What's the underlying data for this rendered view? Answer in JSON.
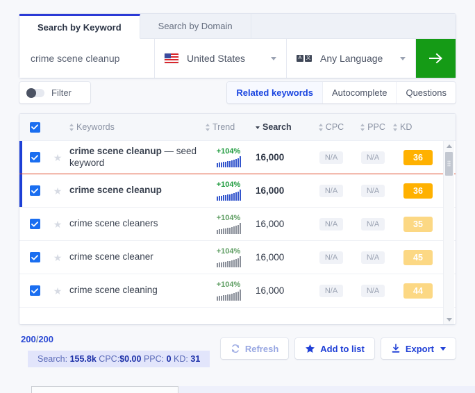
{
  "search_card": {
    "tabs": [
      {
        "label": "Search by Keyword",
        "active": true
      },
      {
        "label": "Search by Domain",
        "active": false
      }
    ],
    "keyword_value": "crime scene cleanup",
    "keyword_placeholder": "Enter keyword",
    "country": "United States",
    "country_icon": "us-flag-icon",
    "language": "Any Language",
    "language_icon": "translate-icon",
    "go_button_icon": "arrow-right-icon",
    "go_button_color": "#159b16"
  },
  "controls": {
    "filter_label": "Filter",
    "filter_enabled": false,
    "segments": [
      {
        "label": "Related keywords",
        "active": true
      },
      {
        "label": "Autocomplete",
        "active": false
      },
      {
        "label": "Questions",
        "active": false
      }
    ]
  },
  "table": {
    "select_all_checked": true,
    "columns": [
      {
        "key": "keywords",
        "label": "Keywords",
        "sort": "both",
        "active": false
      },
      {
        "key": "trend",
        "label": "Trend",
        "sort": "both",
        "active": false
      },
      {
        "key": "search",
        "label": "Search",
        "sort": "desc",
        "active": true
      },
      {
        "key": "cpc",
        "label": "CPC",
        "sort": "both",
        "active": false
      },
      {
        "key": "ppc",
        "label": "PPC",
        "sort": "both",
        "active": false
      },
      {
        "key": "kd",
        "label": "KD",
        "sort": "both",
        "active": false
      }
    ],
    "rows": [
      {
        "checked": true,
        "starred": false,
        "keyword": "crime scene cleanup",
        "suffix": "— seed keyword",
        "bold": true,
        "trend_pct": "+104%",
        "trend_color": "#1f9b3e",
        "spark_color": "#3355cc",
        "search": "16,000",
        "search_bold": true,
        "cpc": "N/A",
        "ppc": "N/A",
        "kd": "36",
        "kd_color": "#ffb100",
        "marked": true,
        "seed_divider": true
      },
      {
        "checked": true,
        "starred": false,
        "keyword": "crime scene cleanup",
        "suffix": "",
        "bold": true,
        "trend_pct": "+104%",
        "trend_color": "#1f9b3e",
        "spark_color": "#3355cc",
        "search": "16,000",
        "search_bold": true,
        "cpc": "N/A",
        "ppc": "N/A",
        "kd": "36",
        "kd_color": "#ffb100",
        "marked": true,
        "seed_divider": false
      },
      {
        "checked": true,
        "starred": false,
        "keyword": "crime scene cleaners",
        "suffix": "",
        "bold": false,
        "trend_pct": "+104%",
        "trend_color": "#5f9e63",
        "spark_color": "#8a8f99",
        "search": "16,000",
        "search_bold": false,
        "cpc": "N/A",
        "ppc": "N/A",
        "kd": "35",
        "kd_color": "#fcd884",
        "marked": false,
        "seed_divider": false
      },
      {
        "checked": true,
        "starred": false,
        "keyword": "crime scene cleaner",
        "suffix": "",
        "bold": false,
        "trend_pct": "+104%",
        "trend_color": "#5f9e63",
        "spark_color": "#8a8f99",
        "search": "16,000",
        "search_bold": false,
        "cpc": "N/A",
        "ppc": "N/A",
        "kd": "45",
        "kd_color": "#fcd884",
        "marked": false,
        "seed_divider": false
      },
      {
        "checked": true,
        "starred": false,
        "keyword": "crime scene cleaning",
        "suffix": "",
        "bold": false,
        "trend_pct": "+104%",
        "trend_color": "#5f9e63",
        "spark_color": "#8a8f99",
        "search": "16,000",
        "search_bold": false,
        "cpc": "N/A",
        "ppc": "N/A",
        "kd": "44",
        "kd_color": "#fcd884",
        "marked": false,
        "seed_divider": false
      }
    ]
  },
  "footer": {
    "count_selected": "200",
    "count_separator": "/",
    "count_total": "200",
    "summary": {
      "search_label": "Search:",
      "search_value": "155.8k",
      "cpc_label": "CPC:",
      "cpc_value": "$0.00",
      "ppc_label": "PPC:",
      "ppc_value": "0",
      "kd_label": "KD:",
      "kd_value": "31"
    },
    "buttons": [
      {
        "label": "Refresh",
        "icon": "refresh-icon",
        "disabled": true
      },
      {
        "label": "Add to list",
        "icon": "star-icon",
        "disabled": false
      },
      {
        "label": "Export",
        "icon": "download-icon",
        "disabled": false,
        "caret": true
      }
    ]
  }
}
